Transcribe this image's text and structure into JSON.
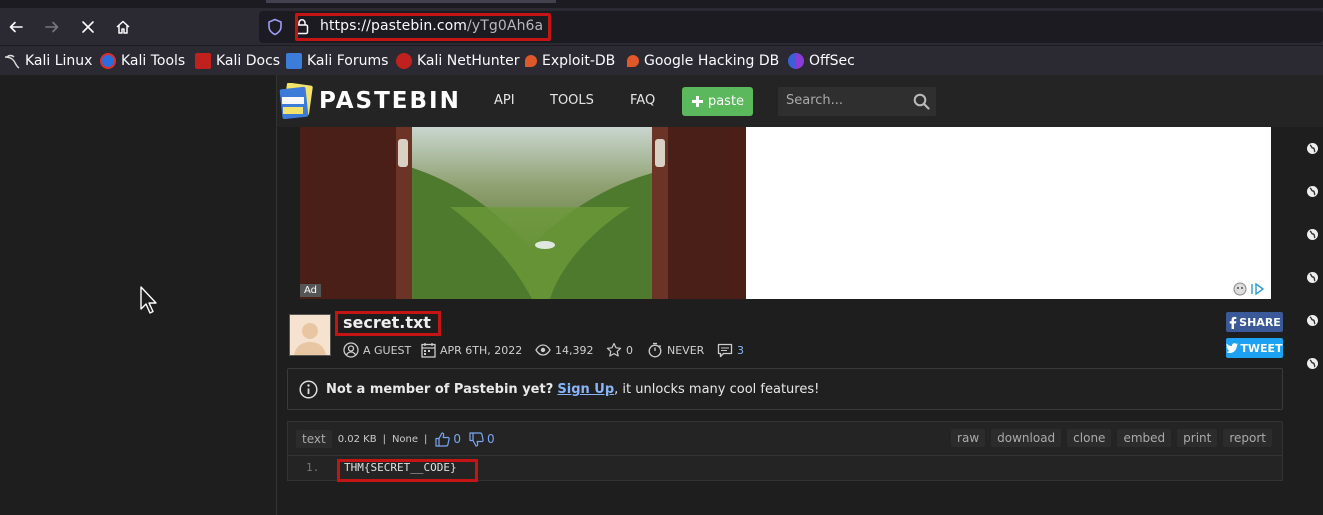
{
  "browser": {
    "url_host": "https://pastebin.com",
    "url_path": "/yTg0Ah6a",
    "bookmarks": [
      {
        "label": "Kali Linux",
        "icon": "kali-dragon-icon"
      },
      {
        "label": "Kali Tools",
        "icon": "kali-tools-icon"
      },
      {
        "label": "Kali Docs",
        "icon": "kali-docs-icon"
      },
      {
        "label": "Kali Forums",
        "icon": "kali-forums-icon"
      },
      {
        "label": "Kali NetHunter",
        "icon": "kali-nethunter-icon"
      },
      {
        "label": "Exploit-DB",
        "icon": "exploit-db-icon"
      },
      {
        "label": "Google Hacking DB",
        "icon": "ghdb-icon"
      },
      {
        "label": "OffSec",
        "icon": "offsec-icon"
      }
    ]
  },
  "header": {
    "logo_text": "PASTEBIN",
    "nav": [
      "API",
      "TOOLS",
      "FAQ"
    ],
    "paste_label": "paste",
    "search_placeholder": "Search..."
  },
  "ad": {
    "label": "Ad"
  },
  "paste": {
    "title": "secret.txt",
    "author": "A GUEST",
    "date": "APR 6TH, 2022",
    "views": "14,392",
    "stars": "0",
    "expires": "NEVER",
    "comments": "3"
  },
  "share": {
    "facebook": "SHARE",
    "twitter": "TWEET"
  },
  "notice": {
    "prefix": "Not a member of Pastebin yet?",
    "link": "Sign Up",
    "suffix": ", it unlocks many cool features!"
  },
  "code_toolbar": {
    "syntax": "text",
    "size": "0.02 KB",
    "sep1": "|",
    "category": "None",
    "sep2": "|",
    "likes": "0",
    "dislikes": "0",
    "actions": [
      "raw",
      "download",
      "clone",
      "embed",
      "print",
      "report"
    ]
  },
  "code": {
    "line_number": "1.",
    "line": "THM{SECRET__CODE}"
  },
  "colors": {
    "highlight": "#c41414",
    "paste_green": "#5cb85c",
    "facebook": "#3b5998",
    "twitter": "#1da1f2"
  }
}
